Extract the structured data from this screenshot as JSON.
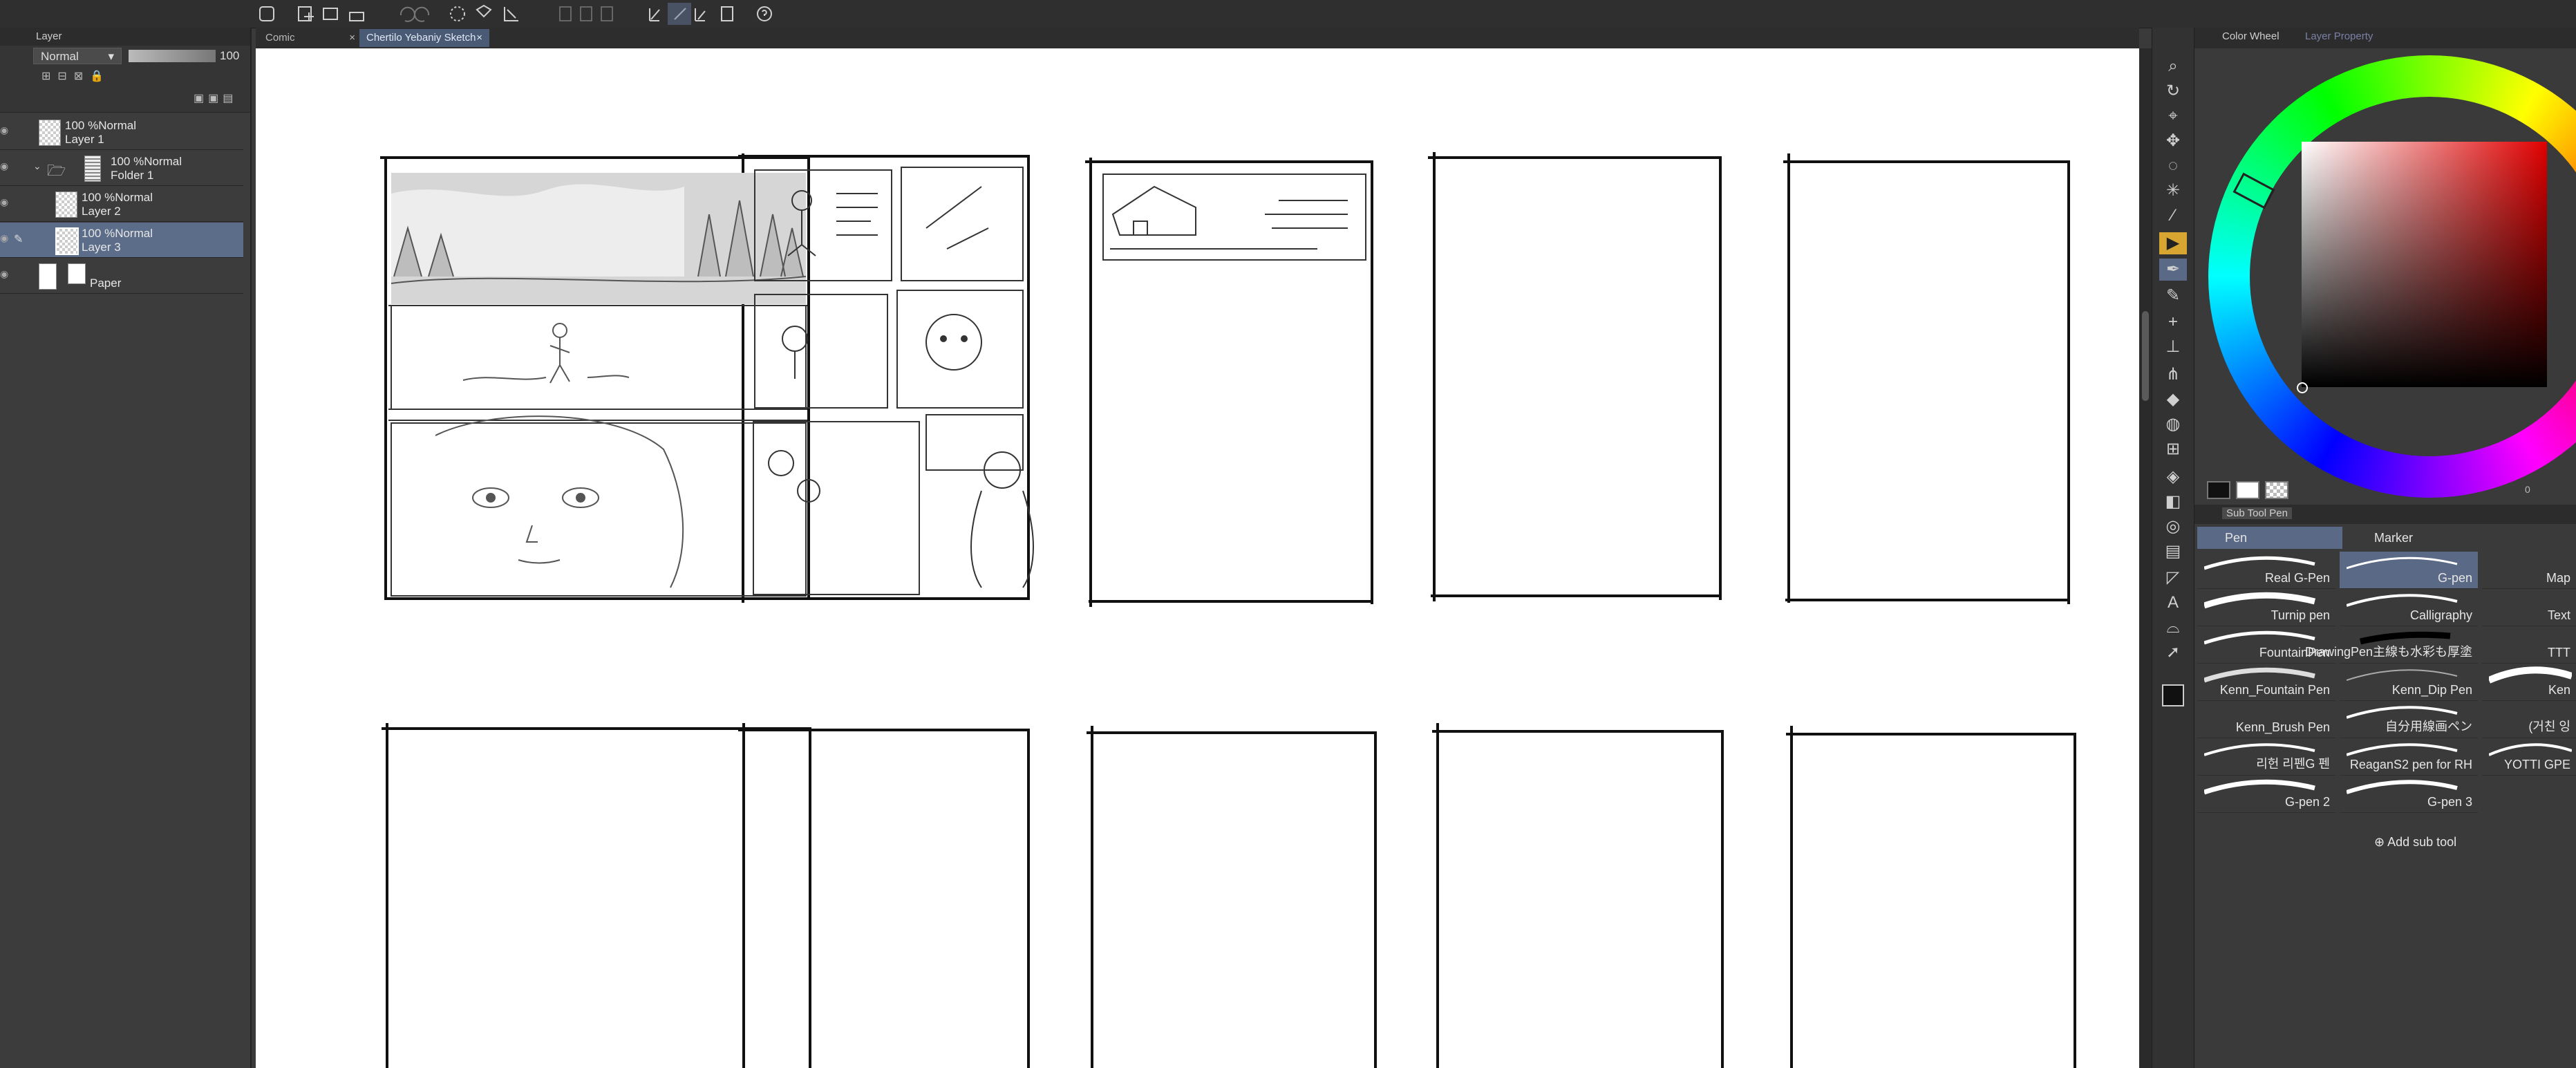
{
  "layer_panel": {
    "tab_title": "Layer",
    "blend_mode": "Normal",
    "opacity": "100",
    "layers": [
      {
        "line1": "100 %Normal",
        "line2": "Layer 1"
      },
      {
        "line1": "100 %Normal",
        "line2": "Folder 1"
      },
      {
        "line1": "100 %Normal",
        "line2": "Layer 2"
      },
      {
        "line1": "100 %Normal",
        "line2": "Layer 3"
      },
      {
        "line1": "",
        "line2": "Paper"
      }
    ]
  },
  "documents": {
    "tabs": [
      {
        "label": "Comic"
      },
      {
        "label": "Chertilo Yebaniy Sketch"
      }
    ]
  },
  "color_panel": {
    "tabs": [
      "Color Wheel",
      "Layer Property"
    ],
    "status_text": "0"
  },
  "subtool_panel": {
    "tab_title": "Sub Tool Pen",
    "categories": [
      "Pen",
      "Marker"
    ],
    "brushes": [
      [
        "Real G-Pen",
        "G-pen",
        "Map"
      ],
      [
        "Turnip pen",
        "Calligraphy",
        "Text"
      ],
      [
        "FountainPen",
        "DrawingPen主線も水彩も厚塗",
        "TTT"
      ],
      [
        "Kenn_Fountain Pen",
        "Kenn_Dip Pen",
        "Ken"
      ],
      [
        "Kenn_Brush Pen",
        "自分用線画ペン",
        "(거친 잉"
      ],
      [
        "리헌 리펜G 펜",
        "ReaganS2 pen for RH",
        "YOTTI GPE"
      ],
      [
        "G-pen 2",
        "G-pen 3",
        ""
      ]
    ],
    "add_label": "Add sub tool"
  }
}
